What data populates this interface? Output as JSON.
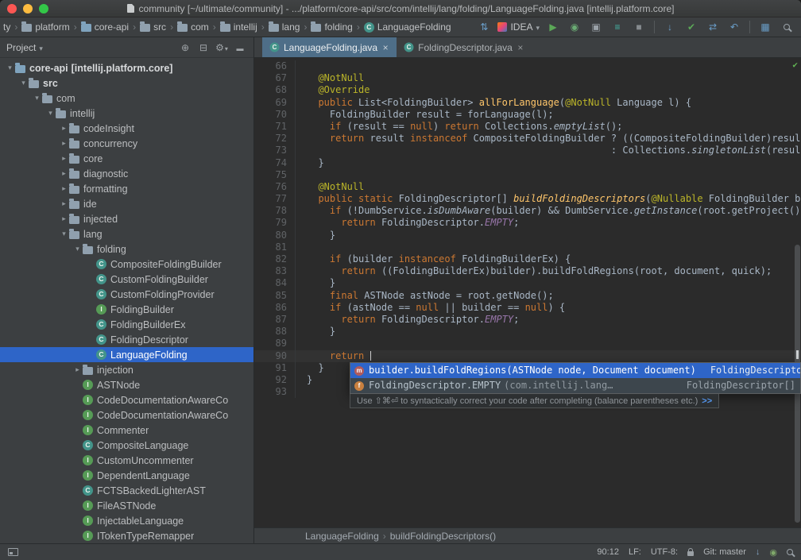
{
  "colors": {
    "sel": "#2e65c8",
    "kw": "#cc7832",
    "ann": "#bbb529",
    "mdecl": "#ffc66b",
    "field": "#9876aa",
    "fg": "#a9b7c6",
    "run": "#5ba757",
    "link": "#5394ec"
  },
  "window": {
    "title": "community [~/ultimate/community] - .../platform/core-api/src/com/intellij/lang/folding/LanguageFolding.java [intellij.platform.core]"
  },
  "navbar": {
    "crumbs": [
      {
        "label": "ty",
        "icon": "none"
      },
      {
        "label": "platform",
        "icon": "folder"
      },
      {
        "label": "core-api",
        "icon": "module"
      },
      {
        "label": "src",
        "icon": "folder"
      },
      {
        "label": "com",
        "icon": "folder"
      },
      {
        "label": "intellij",
        "icon": "folder"
      },
      {
        "label": "lang",
        "icon": "folder"
      },
      {
        "label": "folding",
        "icon": "folder"
      },
      {
        "label": "LanguageFolding",
        "icon": "class"
      }
    ],
    "run_config": {
      "label": "IDEA"
    },
    "toolbar": [
      "sync",
      "run-config",
      "run",
      "coverage",
      "package",
      "build",
      "stop",
      "|",
      "vcs-update",
      "vcs-commit",
      "vcs-changes",
      "rollback",
      "|",
      "toolwindows",
      "search"
    ]
  },
  "project_panel": {
    "title": "Project",
    "tree": [
      {
        "label": "core-api",
        "detail": " [intellij.platform.core]",
        "level": 0,
        "icon": "module",
        "arrow": "open",
        "bold": true
      },
      {
        "label": "src",
        "level": 1,
        "icon": "folder",
        "arrow": "open",
        "bold": true
      },
      {
        "label": "com",
        "level": 2,
        "icon": "folder",
        "arrow": "open"
      },
      {
        "label": "intellij",
        "level": 3,
        "icon": "folder",
        "arrow": "open"
      },
      {
        "label": "codeInsight",
        "level": 4,
        "icon": "folder",
        "arrow": "closed"
      },
      {
        "label": "concurrency",
        "level": 4,
        "icon": "folder",
        "arrow": "closed"
      },
      {
        "label": "core",
        "level": 4,
        "icon": "folder",
        "arrow": "closed"
      },
      {
        "label": "diagnostic",
        "level": 4,
        "icon": "folder",
        "arrow": "closed"
      },
      {
        "label": "formatting",
        "level": 4,
        "icon": "folder",
        "arrow": "closed"
      },
      {
        "label": "ide",
        "level": 4,
        "icon": "folder",
        "arrow": "closed"
      },
      {
        "label": "injected",
        "level": 4,
        "icon": "folder",
        "arrow": "closed"
      },
      {
        "label": "lang",
        "level": 4,
        "icon": "folder",
        "arrow": "open"
      },
      {
        "label": "folding",
        "level": 5,
        "icon": "folder",
        "arrow": "open"
      },
      {
        "label": "CompositeFoldingBuilder",
        "level": 6,
        "icon": "class",
        "arrow": "none"
      },
      {
        "label": "CustomFoldingBuilder",
        "level": 6,
        "icon": "class",
        "arrow": "none"
      },
      {
        "label": "CustomFoldingProvider",
        "level": 6,
        "icon": "class",
        "arrow": "none"
      },
      {
        "label": "FoldingBuilder",
        "level": 6,
        "icon": "interface",
        "arrow": "none"
      },
      {
        "label": "FoldingBuilderEx",
        "level": 6,
        "icon": "class",
        "arrow": "none"
      },
      {
        "label": "FoldingDescriptor",
        "level": 6,
        "icon": "class",
        "arrow": "none"
      },
      {
        "label": "LanguageFolding",
        "level": 6,
        "icon": "class",
        "arrow": "none",
        "selected": true
      },
      {
        "label": "injection",
        "level": 5,
        "icon": "folder",
        "arrow": "closed"
      },
      {
        "label": "ASTNode",
        "level": 5,
        "icon": "interface",
        "arrow": "none"
      },
      {
        "label": "CodeDocumentationAwareCo",
        "level": 5,
        "icon": "interface",
        "arrow": "none"
      },
      {
        "label": "CodeDocumentationAwareCo",
        "level": 5,
        "icon": "interface",
        "arrow": "none"
      },
      {
        "label": "Commenter",
        "level": 5,
        "icon": "interface",
        "arrow": "none"
      },
      {
        "label": "CompositeLanguage",
        "level": 5,
        "icon": "class",
        "arrow": "none"
      },
      {
        "label": "CustomUncommenter",
        "level": 5,
        "icon": "interface",
        "arrow": "none"
      },
      {
        "label": "DependentLanguage",
        "level": 5,
        "icon": "interface",
        "arrow": "none"
      },
      {
        "label": "FCTSBackedLighterAST",
        "level": 5,
        "icon": "class",
        "arrow": "none"
      },
      {
        "label": "FileASTNode",
        "level": 5,
        "icon": "interface",
        "arrow": "none"
      },
      {
        "label": "InjectableLanguage",
        "level": 5,
        "icon": "interface",
        "arrow": "none"
      },
      {
        "label": "ITokenTypeRemapper",
        "level": 5,
        "icon": "interface",
        "arrow": "none"
      }
    ]
  },
  "editor": {
    "tabs": [
      {
        "label": "LanguageFolding.java",
        "active": true
      },
      {
        "label": "FoldingDescriptor.java",
        "active": false
      }
    ],
    "lines": [
      {
        "n": 66,
        "s": []
      },
      {
        "n": 67,
        "s": [
          [
            "",
            "  "
          ],
          [
            "a",
            "@NotNull"
          ]
        ]
      },
      {
        "n": 68,
        "s": [
          [
            "",
            "  "
          ],
          [
            "a",
            "@Override"
          ]
        ]
      },
      {
        "n": 69,
        "s": [
          [
            "",
            "  "
          ],
          [
            "k",
            "public "
          ],
          [
            "",
            "List<FoldingBuilder> "
          ],
          [
            "m",
            "allForLanguage"
          ],
          [
            "",
            "("
          ],
          [
            "a",
            "@NotNull"
          ],
          [
            "",
            " Language l) {"
          ]
        ]
      },
      {
        "n": 70,
        "s": [
          [
            "",
            "    FoldingBuilder result = forLanguage(l);"
          ]
        ]
      },
      {
        "n": 71,
        "s": [
          [
            "",
            "    "
          ],
          [
            "k",
            "if"
          ],
          [
            "",
            " (result == "
          ],
          [
            "k",
            "null"
          ],
          [
            "",
            ") "
          ],
          [
            "k",
            "return"
          ],
          [
            "",
            " Collections."
          ],
          [
            "s",
            "emptyList"
          ],
          [
            "",
            "();"
          ]
        ]
      },
      {
        "n": 72,
        "s": [
          [
            "",
            "    "
          ],
          [
            "k",
            "return"
          ],
          [
            "",
            " result "
          ],
          [
            "k",
            "instanceof"
          ],
          [
            "",
            " CompositeFoldingBuilder ? ((CompositeFoldingBuilder)result).ge"
          ]
        ]
      },
      {
        "n": 73,
        "s": [
          [
            "",
            "                                                     : Collections."
          ],
          [
            "s",
            "singletonList"
          ],
          [
            "",
            "(result);"
          ]
        ]
      },
      {
        "n": 74,
        "s": [
          [
            "",
            "  }"
          ]
        ]
      },
      {
        "n": 75,
        "s": []
      },
      {
        "n": 76,
        "s": [
          [
            "",
            "  "
          ],
          [
            "a",
            "@NotNull"
          ]
        ]
      },
      {
        "n": 77,
        "s": [
          [
            "",
            "  "
          ],
          [
            "k",
            "public static "
          ],
          [
            "",
            "FoldingDescriptor[] "
          ],
          [
            "ms",
            "buildFoldingDescriptors"
          ],
          [
            "",
            "("
          ],
          [
            "a",
            "@Nullable"
          ],
          [
            "",
            " FoldingBuilder builder"
          ]
        ]
      },
      {
        "n": 78,
        "s": [
          [
            "",
            "    "
          ],
          [
            "k",
            "if"
          ],
          [
            "",
            " (!DumbService."
          ],
          [
            "s",
            "isDumbAware"
          ],
          [
            "",
            "(builder) && DumbService."
          ],
          [
            "s",
            "getInstance"
          ],
          [
            "",
            "(root.getProject()).isD"
          ]
        ]
      },
      {
        "n": 79,
        "s": [
          [
            "",
            "      "
          ],
          [
            "k",
            "return"
          ],
          [
            "",
            " FoldingDescriptor."
          ],
          [
            "fs",
            "EMPTY"
          ],
          [
            "",
            ";"
          ]
        ]
      },
      {
        "n": 80,
        "s": [
          [
            "",
            "    }"
          ]
        ]
      },
      {
        "n": 81,
        "s": []
      },
      {
        "n": 82,
        "s": [
          [
            "",
            "    "
          ],
          [
            "k",
            "if"
          ],
          [
            "",
            " (builder "
          ],
          [
            "k",
            "instanceof"
          ],
          [
            "",
            " FoldingBuilderEx) {"
          ]
        ]
      },
      {
        "n": 83,
        "s": [
          [
            "",
            "      "
          ],
          [
            "k",
            "return"
          ],
          [
            "",
            " ((FoldingBuilderEx)builder).buildFoldRegions(root, document, quick);"
          ]
        ]
      },
      {
        "n": 84,
        "s": [
          [
            "",
            "    }"
          ]
        ]
      },
      {
        "n": 85,
        "s": [
          [
            "",
            "    "
          ],
          [
            "k",
            "final"
          ],
          [
            "",
            " ASTNode astNode = root.getNode();"
          ]
        ]
      },
      {
        "n": 86,
        "s": [
          [
            "",
            "    "
          ],
          [
            "k",
            "if"
          ],
          [
            "",
            " (astNode == "
          ],
          [
            "k",
            "null"
          ],
          [
            "",
            " || builder == "
          ],
          [
            "k",
            "null"
          ],
          [
            "",
            ") {"
          ]
        ]
      },
      {
        "n": 87,
        "s": [
          [
            "",
            "      "
          ],
          [
            "k",
            "return"
          ],
          [
            "",
            " FoldingDescriptor."
          ],
          [
            "fs",
            "EMPTY"
          ],
          [
            "",
            ";"
          ]
        ]
      },
      {
        "n": 88,
        "s": [
          [
            "",
            "    }"
          ]
        ]
      },
      {
        "n": 89,
        "s": []
      },
      {
        "n": 90,
        "s": [
          [
            "",
            "    "
          ],
          [
            "k",
            "return"
          ],
          [
            "",
            " "
          ]
        ],
        "caret": true,
        "current": true
      },
      {
        "n": 91,
        "s": [
          [
            "",
            "  }"
          ]
        ]
      },
      {
        "n": 92,
        "s": [
          [
            "",
            "}"
          ]
        ]
      },
      {
        "n": 93,
        "s": []
      }
    ],
    "breadcrumbs": [
      "LanguageFolding",
      "buildFoldingDescriptors()"
    ]
  },
  "completion": {
    "items": [
      {
        "icon": "method",
        "label": "builder.buildFoldRegions(ASTNode node, Document document)",
        "type": "FoldingDescriptor[]",
        "selected": true
      },
      {
        "icon": "field",
        "label": "FoldingDescriptor.EMPTY",
        "detail": "(com.intellij.lang…",
        "type": "FoldingDescriptor[]",
        "selected": false
      }
    ],
    "hint": "Use ⇧⌘⏎ to syntactically correct your code after completing (balance parentheses etc.)",
    "hint_more": ">>"
  },
  "status_bar": {
    "position": "90:12",
    "line_separator": "LF:",
    "encoding": "UTF-8:",
    "vcs": "Git: master"
  }
}
